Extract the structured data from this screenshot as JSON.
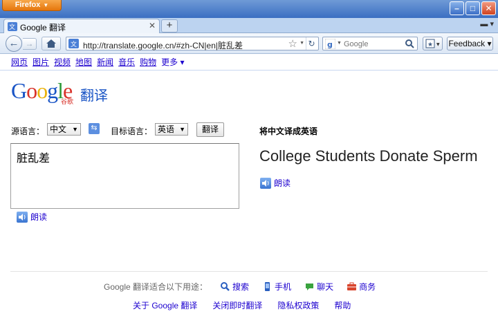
{
  "browser": {
    "menu_button": "Firefox",
    "tab_title": "Google 翻译",
    "url": "http://translate.google.cn/#zh-CN|en|脏乱差",
    "search_placeholder": "Google",
    "feedback_label": "Feedback"
  },
  "gbar": {
    "links": [
      "网页",
      "图片",
      "视频",
      "地图",
      "新闻",
      "音乐",
      "购物"
    ],
    "more": "更多 ▾"
  },
  "logo": {
    "g1": "G",
    "o1": "o",
    "o2": "o",
    "g2": "g",
    "l": "l",
    "e": "e",
    "sub": "谷歌",
    "product": "翻译"
  },
  "lang_bar": {
    "source_label": "源语言：",
    "source_value": "中文",
    "target_label": "目标语言：",
    "target_value": "英语",
    "translate_button": "翻译"
  },
  "source": {
    "text": "脏乱差",
    "listen": "朗读"
  },
  "result": {
    "heading": "将中文译成英语",
    "text": "College Students Donate Sperm",
    "listen": "朗读"
  },
  "usage": {
    "intro": "Google 翻译适合以下用途：",
    "items": [
      {
        "label": "搜索",
        "icon": "search-icon"
      },
      {
        "label": "手机",
        "icon": "phone-icon"
      },
      {
        "label": "聊天",
        "icon": "chat-icon"
      },
      {
        "label": "商务",
        "icon": "briefcase-icon"
      }
    ]
  },
  "footer_links": [
    "关于 Google 翻译",
    "关闭即时翻译",
    "隐私权政策",
    "帮助"
  ]
}
